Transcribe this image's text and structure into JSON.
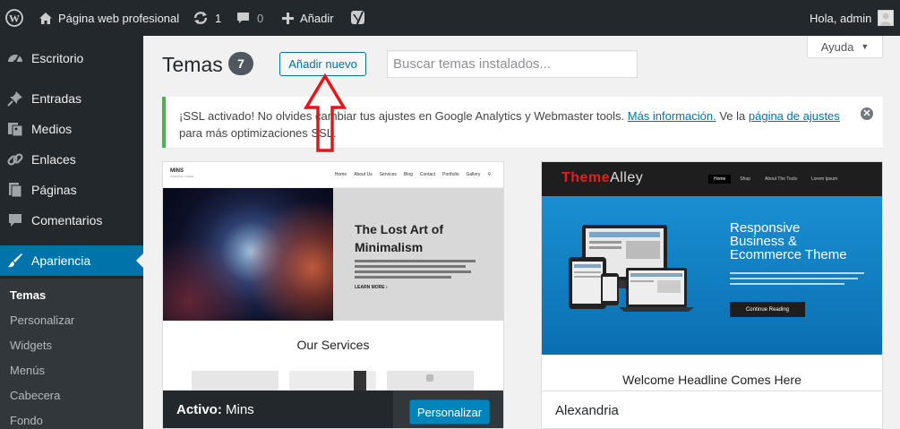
{
  "adminbar": {
    "site_name": "Página web profesional",
    "updates_count": "1",
    "comments_count": "0",
    "new_label": "Añadir",
    "greeting": "Hola, admin"
  },
  "sidebar": {
    "items": [
      {
        "label": "Escritorio",
        "icon": "dashboard-icon"
      },
      {
        "label": "Entradas",
        "icon": "pin-icon"
      },
      {
        "label": "Medios",
        "icon": "media-icon"
      },
      {
        "label": "Enlaces",
        "icon": "link-icon"
      },
      {
        "label": "Páginas",
        "icon": "pages-icon"
      },
      {
        "label": "Comentarios",
        "icon": "comment-icon"
      },
      {
        "label": "Apariencia",
        "icon": "brush-icon"
      }
    ],
    "submenu": [
      "Temas",
      "Personalizar",
      "Widgets",
      "Menús",
      "Cabecera",
      "Fondo"
    ]
  },
  "header": {
    "title": "Temas",
    "count": "7",
    "add_new": "Añadir nuevo",
    "search_placeholder": "Buscar temas instalados...",
    "help": "Ayuda"
  },
  "notice": {
    "text_before": "¡SSL activado!  No olvides cambiar tus ajustes en Google Analytics y Webmaster tools. ",
    "link1": "Más información.",
    "text_middle": " Ve la ",
    "link2": "página de ajustes",
    "text_after": " para más optimizaciones SSL."
  },
  "themes": {
    "active": {
      "prefix": "Activo:",
      "name": "Mins",
      "customize": "Personalizar",
      "screenshot": {
        "logo": "MINS",
        "tagline": "A MINIMAL THEME",
        "nav": [
          "Home",
          "About Us",
          "Services",
          "Blog",
          "Contact",
          "Portfolio",
          "Gallery"
        ],
        "hero_title": "The Lost Art of Minimalism",
        "read_more": "LEARN MORE ›",
        "services": "Our Services"
      }
    },
    "other": {
      "name": "Alexandria",
      "screenshot": {
        "logo_a": "Theme",
        "logo_b": "Alley",
        "nav": [
          "Home",
          "Shop",
          "About The Tools",
          "Lorem Ipsum"
        ],
        "hero_title": "Responsive Business & Ecommerce Theme",
        "button": "Continue Reading",
        "welcome": "Welcome Headline Comes Here"
      }
    }
  }
}
